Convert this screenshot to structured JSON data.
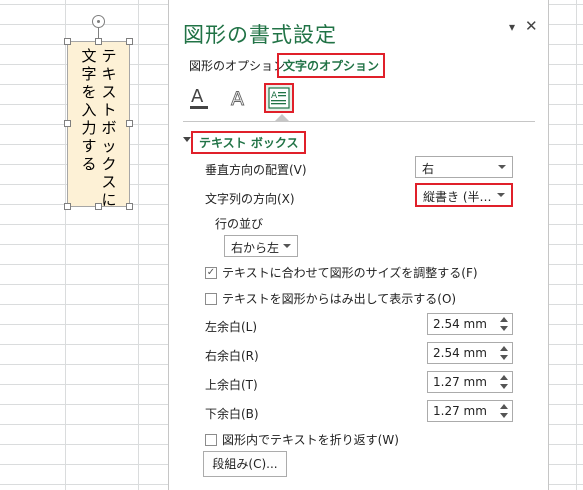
{
  "shape_text": {
    "line1": "テキストボックスに",
    "line2": "文字を入力する"
  },
  "pane": {
    "title": "図形の書式設定",
    "dropdown_glyph": "▾",
    "close_glyph": "✕",
    "tabs": [
      "図形のオプション",
      "文字のオプション"
    ],
    "section": "テキスト ボックス"
  },
  "fields": {
    "vertical_align_label": "垂直方向の配置(V)",
    "vertical_align_value": "右",
    "text_direction_label": "文字列の方向(X)",
    "text_direction_value": "縦書き (半…",
    "line_order_label": "行の並び",
    "line_order_value": "右から左",
    "autofit_label": "テキストに合わせて図形のサイズを調整する(F)",
    "autofit_checked": "✓",
    "overflow_label": "テキストを図形からはみ出して表示する(O)",
    "left_margin_label": "左余白(L)",
    "left_margin_value": "2.54 mm",
    "right_margin_label": "右余白(R)",
    "right_margin_value": "2.54 mm",
    "top_margin_label": "上余白(T)",
    "top_margin_value": "1.27 mm",
    "bottom_margin_label": "下余白(B)",
    "bottom_margin_value": "1.27 mm",
    "wrap_label": "図形内でテキストを折り返す(W)",
    "columns_button": "段組み(C)..."
  },
  "colors": {
    "accent": "#217346",
    "highlight": "#e0202a",
    "shape_fill": "#fdf1d6"
  },
  "icons": [
    "text-fill-icon",
    "text-outline-icon",
    "textbox-icon"
  ]
}
